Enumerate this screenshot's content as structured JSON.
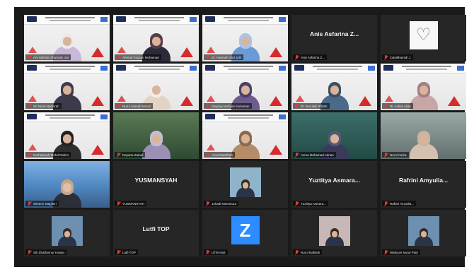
{
  "meeting": {
    "participants": [
      {
        "name": "Ani Wahida Sharinah Jus",
        "type": "slide",
        "active": true,
        "muted": false
      },
      {
        "name": "Ahmad Fauzan Mohamad",
        "type": "slide",
        "muted": true
      },
      {
        "name": "Dr. Hasmah Abd Jalil",
        "type": "slide",
        "muted": true
      },
      {
        "name": "Anis Asfarina Z...",
        "type": "name",
        "muted": true
      },
      {
        "name": "Zulaikhamidi J.",
        "type": "heart-avatar",
        "muted": true
      },
      {
        "name": "Sri Nurul Nadzirah",
        "type": "slide",
        "muted": true
      },
      {
        "name": "Nurul Jannah Ismail",
        "type": "slide",
        "muted": true
      },
      {
        "name": "Dayang Norbaini Sulaiman",
        "type": "slide",
        "muted": true
      },
      {
        "name": "Dr. Norulaili Rifdah",
        "type": "slide",
        "muted": true
      },
      {
        "name": "Dr. Azlina Alias",
        "type": "slide",
        "muted": true
      },
      {
        "name": "Norhasmah Mohd Rahim",
        "type": "slide",
        "muted": true
      },
      {
        "name": "Dayana Zainal",
        "type": "green",
        "muted": true
      },
      {
        "name": "Ainul Mardhiah",
        "type": "slide",
        "muted": true
      },
      {
        "name": "Asma Mohamad Adnan",
        "type": "teal",
        "muted": true
      },
      {
        "name": "Norul Amira",
        "type": "room",
        "muted": true
      },
      {
        "name": "Simeon Staglieri",
        "type": "city",
        "muted": true
      },
      {
        "name": "YUSMANSYAH",
        "type": "name",
        "muted": true
      },
      {
        "name": "Juhadi Kaesmura",
        "type": "photo-avatar",
        "muted": true
      },
      {
        "name": "Yuztitya Asmara...",
        "type": "name",
        "muted": true
      },
      {
        "name": "Rafrini Amyulia...",
        "type": "name",
        "muted": true
      },
      {
        "name": "Siti Sharfannur Hasan",
        "type": "photo-avatar",
        "muted": true
      },
      {
        "name": "Lutfi TOP",
        "type": "name",
        "muted": true
      },
      {
        "name": "UTM Asst",
        "type": "z-avatar",
        "muted": true
      },
      {
        "name": "Nurul Nabilah",
        "type": "photo-avatar",
        "muted": true
      },
      {
        "name": "Wahyuni Nurul Putri",
        "type": "photo-avatar",
        "muted": true
      }
    ]
  },
  "colors": {
    "window_bg": "#1a1a1a",
    "tile_bg": "#262626",
    "active_border": "#d6e84a",
    "mic_muted": "#e03b3b",
    "slide_red": "#d72b2b",
    "zoom_blue": "#2d8cff"
  }
}
